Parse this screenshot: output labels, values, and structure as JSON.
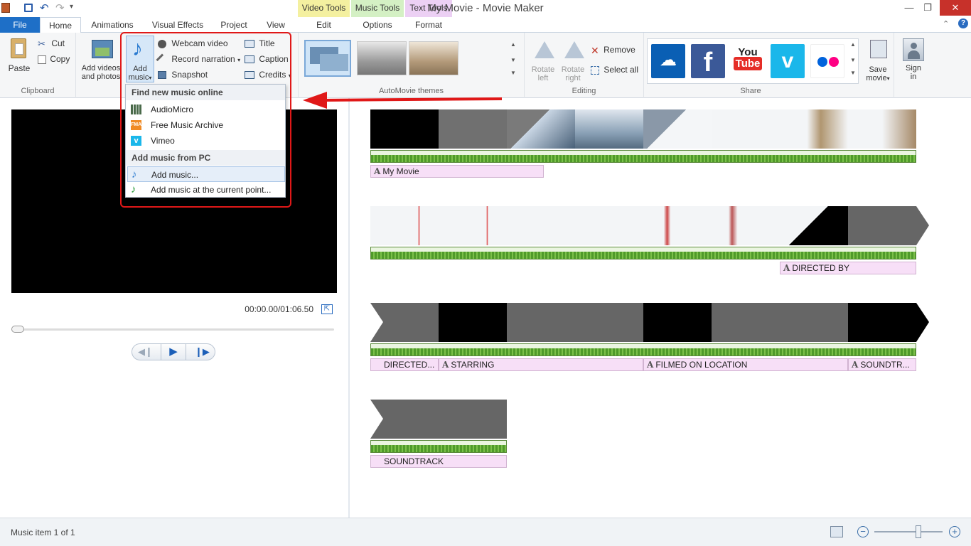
{
  "window": {
    "title": "My Movie - Movie Maker",
    "context_tabs": [
      "Video Tools",
      "Music Tools",
      "Text Tools"
    ]
  },
  "tabs": {
    "file": "File",
    "home": "Home",
    "animations": "Animations",
    "visual_effects": "Visual Effects",
    "project": "Project",
    "view": "View",
    "edit": "Edit",
    "options": "Options",
    "format": "Format"
  },
  "ribbon": {
    "clipboard": {
      "label": "Clipboard",
      "paste": "Paste",
      "cut": "Cut",
      "copy": "Copy"
    },
    "add": {
      "add_videos": "Add videos",
      "and_photos": "and photos",
      "add_music_1": "Add",
      "add_music_2": "music",
      "webcam": "Webcam video",
      "narration": "Record narration",
      "snapshot": "Snapshot",
      "title": "Title",
      "caption": "Caption",
      "credits": "Credits"
    },
    "themes": {
      "label": "AutoMovie themes"
    },
    "editing": {
      "label": "Editing",
      "rotate_left_1": "Rotate",
      "rotate_left_2": "left",
      "rotate_right_1": "Rotate",
      "rotate_right_2": "right",
      "remove": "Remove",
      "select_all": "Select all"
    },
    "share": {
      "label": "Share",
      "save_movie_1": "Save",
      "save_movie_2": "movie",
      "sign_in_1": "Sign",
      "sign_in_2": "in",
      "youtube_1": "You",
      "youtube_2": "Tube"
    }
  },
  "dropdown": {
    "online_header": "Find new music online",
    "items_online": [
      "AudioMicro",
      "Free Music Archive",
      "Vimeo"
    ],
    "pc_header": "Add music from PC",
    "add_music": "Add music...",
    "add_music_point": "Add music at the current point..."
  },
  "preview": {
    "timecode": "00:00.00/01:06.50"
  },
  "timeline": {
    "row1_caption": "My Movie",
    "row2_caption": "DIRECTED BY",
    "row3_captions": [
      "DIRECTED...",
      "STARRING",
      "FILMED ON LOCATION",
      "SOUNDTR..."
    ],
    "row4_caption": "SOUNDTRACK"
  },
  "status": {
    "text": "Music item 1 of 1"
  },
  "colors": {
    "file_tab": "#1e6fc7",
    "video_tools": "#f4f0a0",
    "music_tools": "#d4f0c4",
    "text_tools": "#ecd0f4",
    "highlight": "#e01818",
    "arrow": "#e01818"
  }
}
